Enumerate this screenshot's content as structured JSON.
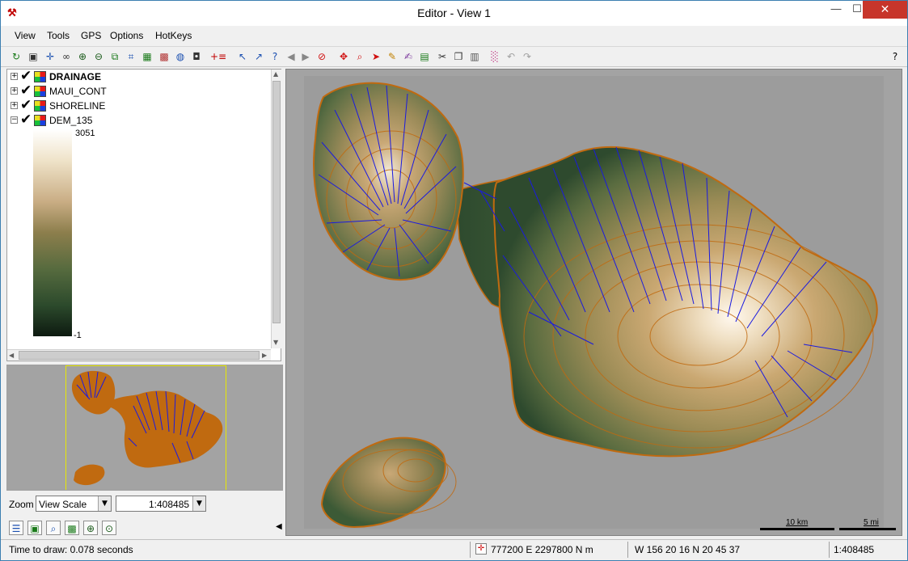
{
  "window": {
    "title": "Editor - View 1",
    "min_glyph": "—",
    "max_glyph": "☐",
    "close_glyph": "✕"
  },
  "menu": [
    "View",
    "Tools",
    "GPS",
    "Options",
    "HotKeys"
  ],
  "toolbar": {
    "icons": [
      {
        "name": "redraw-icon",
        "glyph": "↻",
        "color": "#1a7a1a"
      },
      {
        "name": "full-view-icon",
        "glyph": "▣",
        "color": "#333333"
      },
      {
        "name": "pan-icon",
        "glyph": "✛",
        "color": "#1a4fb0"
      },
      {
        "name": "binoculars-icon",
        "glyph": "∞",
        "color": "#333333"
      },
      {
        "name": "zoom-in-icon",
        "glyph": "⊕",
        "color": "#1a5a1a"
      },
      {
        "name": "zoom-out-icon",
        "glyph": "⊖",
        "color": "#1a5a1a"
      },
      {
        "name": "zoom-box-icon",
        "glyph": "⧉",
        "color": "#1a7a1a"
      },
      {
        "name": "zoom-extent-icon",
        "glyph": "⌗",
        "color": "#1a4fb0"
      },
      {
        "name": "layer-manager-icon",
        "glyph": "▦",
        "color": "#1a7a1a"
      },
      {
        "name": "map-grid-icon",
        "glyph": "▩",
        "color": "#b03030"
      },
      {
        "name": "globe-icon",
        "glyph": "◍",
        "color": "#1a4fb0"
      },
      {
        "name": "camera-icon",
        "glyph": "◘",
        "color": "#333333"
      },
      {
        "name": "add-layer-icon",
        "glyph": "+≡",
        "color": "#c00000"
      },
      {
        "name": "select-element-icon",
        "glyph": "↖",
        "color": "#1a4fb0"
      },
      {
        "name": "select-multiple-icon",
        "glyph": "↗",
        "color": "#1a4fb0"
      },
      {
        "name": "query-icon",
        "glyph": "?",
        "color": "#1a4fb0"
      },
      {
        "name": "previous-icon",
        "glyph": "◀",
        "color": "#888888"
      },
      {
        "name": "next-icon",
        "glyph": "▶",
        "color": "#888888"
      },
      {
        "name": "cancel-icon",
        "glyph": "⊘",
        "color": "#d01010"
      },
      {
        "name": "move-icon",
        "glyph": "✥",
        "color": "#d01010"
      },
      {
        "name": "zoom-tool-icon",
        "glyph": "⌕",
        "color": "#d01010"
      },
      {
        "name": "pointer-icon",
        "glyph": "➤",
        "color": "#d01010"
      },
      {
        "name": "pencil-icon",
        "glyph": "✎",
        "color": "#c08000"
      },
      {
        "name": "edit-attributes-icon",
        "glyph": "✍",
        "color": "#8040a0"
      },
      {
        "name": "raster-icon",
        "glyph": "▤",
        "color": "#1a7a1a"
      },
      {
        "name": "cut-icon",
        "glyph": "✂",
        "color": "#333333"
      },
      {
        "name": "copy-icon",
        "glyph": "❐",
        "color": "#333333"
      },
      {
        "name": "paste-icon",
        "glyph": "▥",
        "color": "#555555"
      },
      {
        "name": "palette-icon",
        "glyph": "░",
        "color": "#c03080"
      },
      {
        "name": "undo-icon",
        "glyph": "↶",
        "color": "#a0a0a0"
      },
      {
        "name": "redo-icon",
        "glyph": "↷",
        "color": "#a0a0a0"
      },
      {
        "name": "help-icon",
        "glyph": "?",
        "color": "#000000"
      }
    ]
  },
  "layers": [
    {
      "name": "DRAINAGE",
      "bold": true,
      "expander": "+"
    },
    {
      "name": "MAUI_CONT",
      "bold": false,
      "expander": "+"
    },
    {
      "name": "SHORELINE",
      "bold": false,
      "expander": "+"
    },
    {
      "name": "DEM_135",
      "bold": false,
      "expander": "−"
    }
  ],
  "legend": {
    "max": "3051",
    "min": "-1"
  },
  "zoom": {
    "label": "Zoom",
    "mode": "View Scale",
    "scale": "1:408485"
  },
  "bottom_tools": [
    {
      "name": "layer-list-icon",
      "glyph": "☰",
      "color": "#1a4fb0"
    },
    {
      "name": "layer-controls-icon",
      "glyph": "▣",
      "color": "#1a7a1a"
    },
    {
      "name": "magnifier-icon",
      "glyph": "⌕",
      "color": "#1a4fb0"
    },
    {
      "name": "map-view-icon",
      "glyph": "▩",
      "color": "#1a7a1a"
    },
    {
      "name": "zoom-locate-icon",
      "glyph": "⊕",
      "color": "#1a5a1a"
    },
    {
      "name": "zoom-target-icon",
      "glyph": "⊙",
      "color": "#1a5a1a"
    }
  ],
  "scalebar": {
    "km_label": "10 km",
    "mi_label": "5 mi"
  },
  "status": {
    "draw_time": "Time to draw: 0.078 seconds",
    "easting_northing": "777200 E  2297800 N m",
    "lat_lon": "W 156 20 16  N 20 45 37",
    "scale": "1:408485"
  },
  "colors": {
    "drainage": "#1a1ae0",
    "contour": "#c06a10",
    "low_elevation": "#2c4a2c",
    "mid_elevation": "#8c7e4c",
    "high_elevation": "#ffffff"
  }
}
